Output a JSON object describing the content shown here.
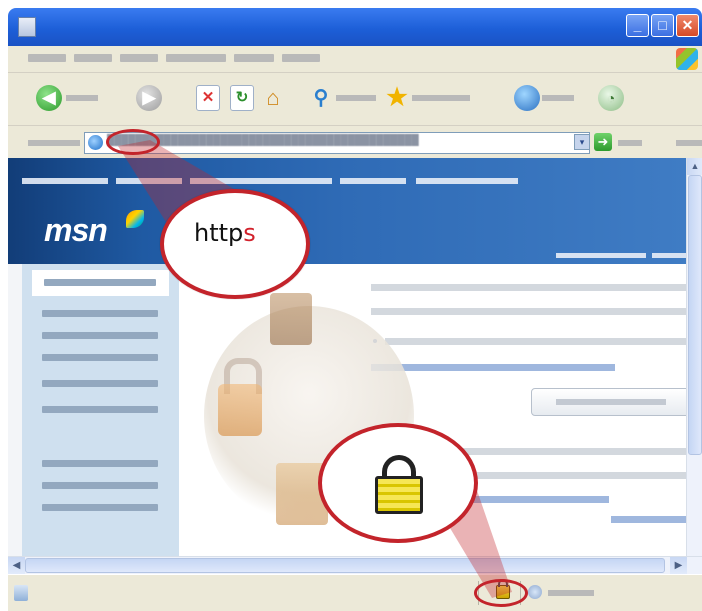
{
  "title_bar": {
    "buttons": [
      "minimize",
      "maximize",
      "close"
    ]
  },
  "callouts": {
    "https": {
      "prefix": "http",
      "highlight": "s"
    },
    "lock_icon": "padlock-icon"
  },
  "site": {
    "logo": "msn"
  },
  "colors": {
    "callout_border": "#c3242b",
    "https_highlight": "#d2212b",
    "msn_header": "#2f6bb6",
    "left_nav": "#cfe0ef",
    "chrome": "#ece9d8"
  },
  "icons": {
    "back": "back-arrow-icon",
    "forward": "forward-arrow-icon",
    "stop": "stop-icon",
    "refresh": "refresh-icon",
    "home": "home-icon",
    "search": "search-icon",
    "favorites": "star-icon",
    "media": "globe-icon",
    "history": "history-icon",
    "go": "go-arrow-icon",
    "status_lock": "padlock-icon"
  }
}
